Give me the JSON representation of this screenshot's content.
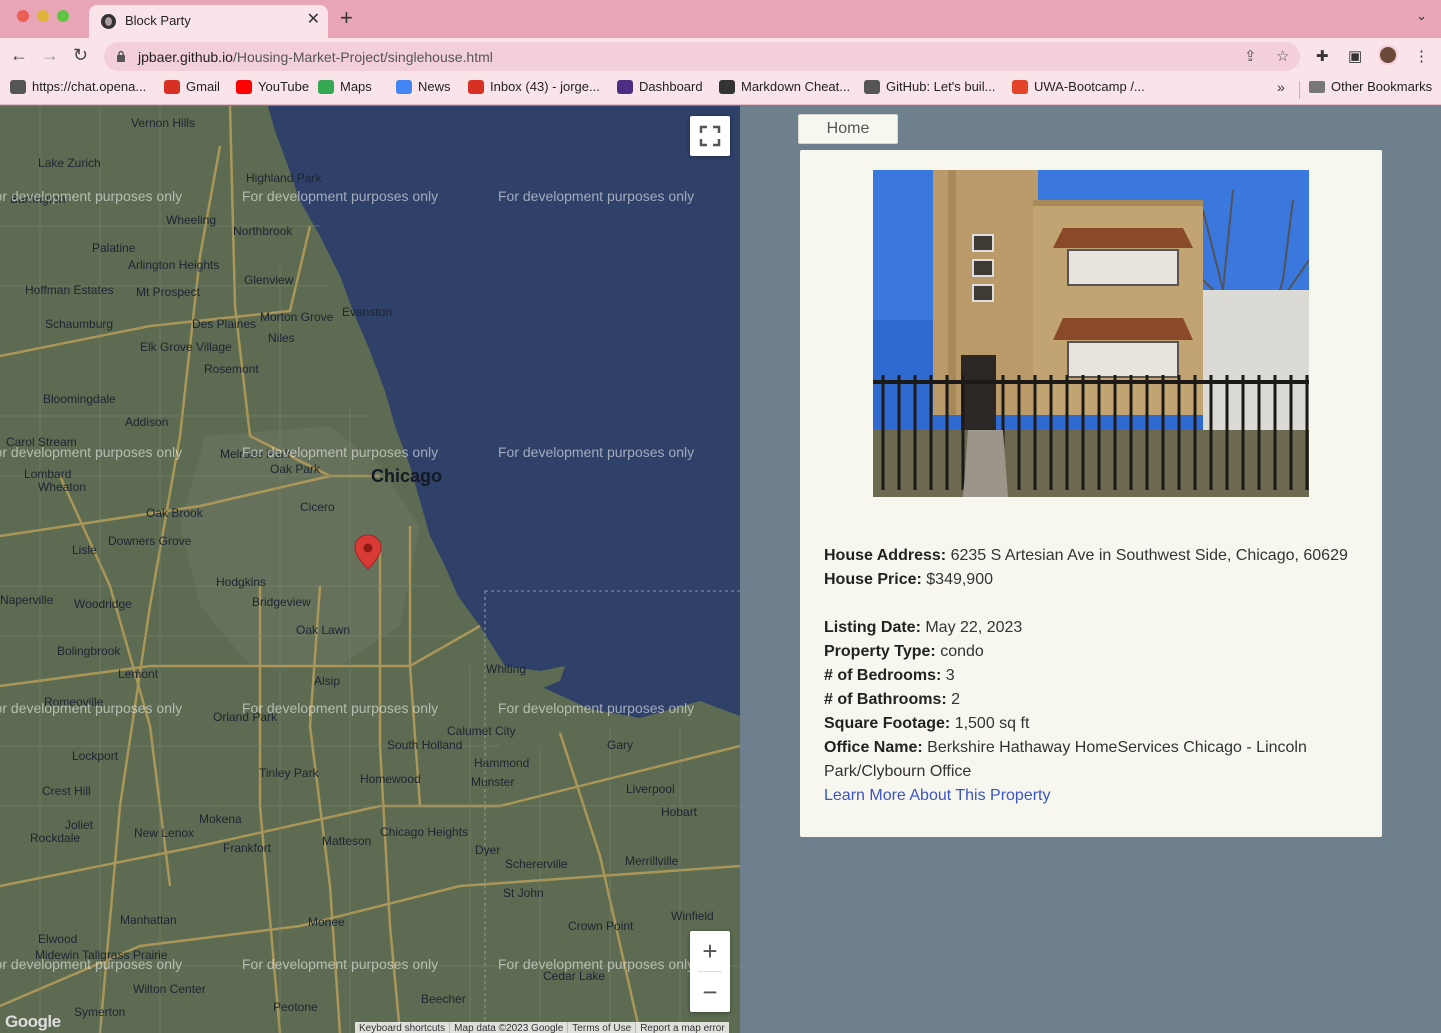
{
  "browser": {
    "tab_title": "Block Party",
    "url_host": "jpbaer.github.io",
    "url_path": "/Housing-Market-Project/singlehouse.html",
    "bookmarks": [
      {
        "label": "https://chat.opena...",
        "icon": "chatgpt-icon",
        "color": "#555555"
      },
      {
        "label": "Gmail",
        "icon": "gmail-icon",
        "color": "#d93025"
      },
      {
        "label": "YouTube",
        "icon": "youtube-icon",
        "color": "#ff0000"
      },
      {
        "label": "Maps",
        "icon": "maps-icon",
        "color": "#34a853"
      },
      {
        "label": "News",
        "icon": "news-icon",
        "color": "#4285f4"
      },
      {
        "label": "Inbox (43) - jorge...",
        "icon": "gmail-icon",
        "color": "#d93025"
      },
      {
        "label": "Dashboard",
        "icon": "w-icon",
        "color": "#4b2e83"
      },
      {
        "label": "Markdown Cheat...",
        "icon": "markdown-icon",
        "color": "#333333"
      },
      {
        "label": "GitHub: Let's buil...",
        "icon": "github-icon",
        "color": "#555555"
      },
      {
        "label": "UWA-Bootcamp /...",
        "icon": "gitlab-icon",
        "color": "#e24329"
      }
    ],
    "other_bookmarks": "Other Bookmarks"
  },
  "map": {
    "city_label": "Chicago",
    "watermark": "For development purposes only",
    "place_labels": [
      "Vernon Hills",
      "Lake Zurich",
      "Highland Park",
      "Barrington",
      "Palatine",
      "Wheeling",
      "Northbrook",
      "Glenview",
      "Arlington Heights",
      "Mt Prospect",
      "Hoffman Estates",
      "Schaumburg",
      "Des Plaines",
      "Morton Grove",
      "Evanston",
      "Niles",
      "Elk Grove Village",
      "Rosemont",
      "Bloomingdale",
      "Addison",
      "Carol Stream",
      "Melrose Park",
      "Oak Park",
      "Wheaton",
      "Lombard",
      "Cicero",
      "Oak Brook",
      "Lisle",
      "Downers Grove",
      "Hodgkins",
      "Bridgeview",
      "Naperville",
      "Woodridge",
      "Oak Lawn",
      "Bolingbrook",
      "Lemont",
      "Alsip",
      "Whiting",
      "Romeoville",
      "Orland Park",
      "Calumet City",
      "South Holland",
      "Gary",
      "Lockport",
      "Tinley Park",
      "Homewood",
      "Hammond",
      "Munster",
      "Crest Hill",
      "Mokena",
      "Liverpool",
      "Hobart",
      "Joliet",
      "New Lenox",
      "Frankfort",
      "Rockdale",
      "Chicago Heights",
      "Matteson",
      "Dyer",
      "Schererville",
      "Merrillville",
      "St John",
      "Manhattan",
      "Monee",
      "Crown Point",
      "Winfield",
      "Elwood",
      "Midewin Tallgrass Prairie",
      "Wilton Center",
      "Cedar Lake",
      "Symerton",
      "Peotone",
      "Beecher"
    ],
    "footer": [
      "Keyboard shortcuts",
      "Map data ©2023 Google",
      "Terms of Use",
      "Report a map error"
    ],
    "logo": "Google",
    "zoom_in": "+",
    "zoom_out": "−"
  },
  "page": {
    "home_label": "Home",
    "listing": {
      "address_label": "House Address:",
      "address": "6235 S Artesian Ave in Southwest Side, Chicago, 60629",
      "price_label": "House Price:",
      "price": "$349,900",
      "date_label": "Listing Date:",
      "date": "May 22, 2023",
      "type_label": "Property Type:",
      "type": "condo",
      "bedrooms_label": "# of Bedrooms:",
      "bedrooms": "3",
      "bathrooms_label": "# of Bathrooms:",
      "bathrooms": "2",
      "sqft_label": "Square Footage:",
      "sqft": "1,500 sq ft",
      "office_label": "Office Name:",
      "office": "Berkshire Hathaway HomeServices Chicago - Lincoln Park/Clybourn Office",
      "link_label": "Learn More About This Property"
    }
  },
  "colors": {
    "tab_bar": "#e8a5b5",
    "toolbar": "#fbe3ea",
    "lake": "#2f4069",
    "land": "#5c6b52",
    "page_bg": "#6e7f8e",
    "card_bg": "#f8f7ef",
    "link": "#3b55c4",
    "marker": "#d93a35"
  }
}
